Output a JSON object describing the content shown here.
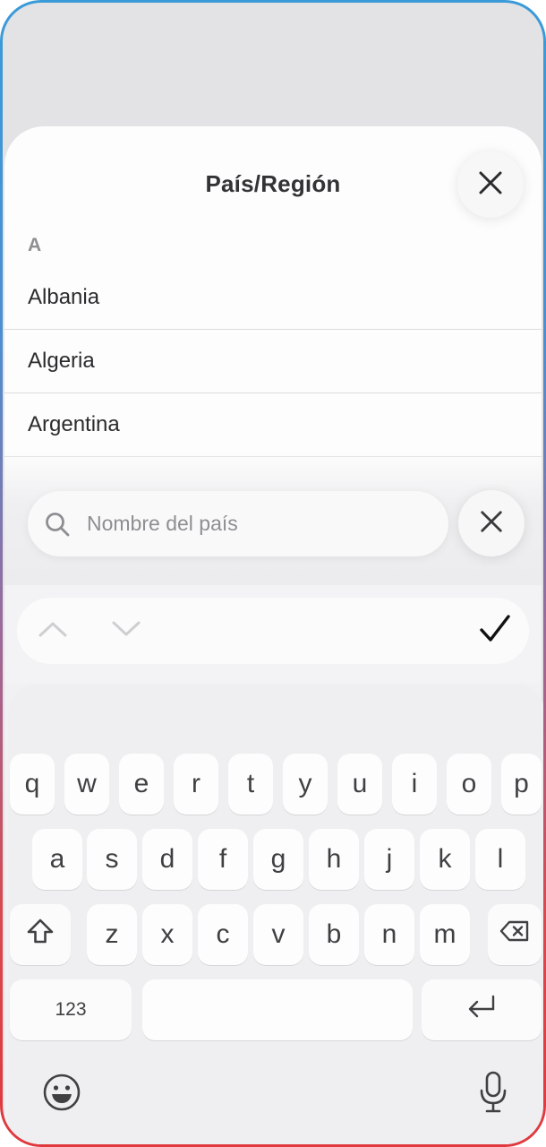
{
  "sheet": {
    "title": "País/Región",
    "close_icon": "close-icon"
  },
  "list": {
    "section_letter": "A",
    "countries": [
      "Albania",
      "Algeria",
      "Argentina"
    ]
  },
  "search": {
    "placeholder": "Nombre del país",
    "icon": "search-icon",
    "clear_icon": "close-icon"
  },
  "accessory": {
    "prev_icon": "chevron-up-icon",
    "next_icon": "chevron-down-icon",
    "done_icon": "checkmark-icon"
  },
  "keyboard": {
    "row1": [
      "q",
      "w",
      "e",
      "r",
      "t",
      "y",
      "u",
      "i",
      "o",
      "p"
    ],
    "row2": [
      "a",
      "s",
      "d",
      "f",
      "g",
      "h",
      "j",
      "k",
      "l"
    ],
    "row3": [
      "z",
      "x",
      "c",
      "v",
      "b",
      "n",
      "m"
    ],
    "numbers_label": "123",
    "shift_icon": "shift-icon",
    "delete_icon": "backspace-icon",
    "return_icon": "return-icon",
    "emoji_icon": "emoji-icon",
    "mic_icon": "microphone-icon"
  },
  "colors": {
    "frame_top": "#3a9bd8",
    "frame_bottom": "#e0393d",
    "sheet_bg": "#fdfdfd",
    "keyboard_bg": "#efeff1"
  }
}
